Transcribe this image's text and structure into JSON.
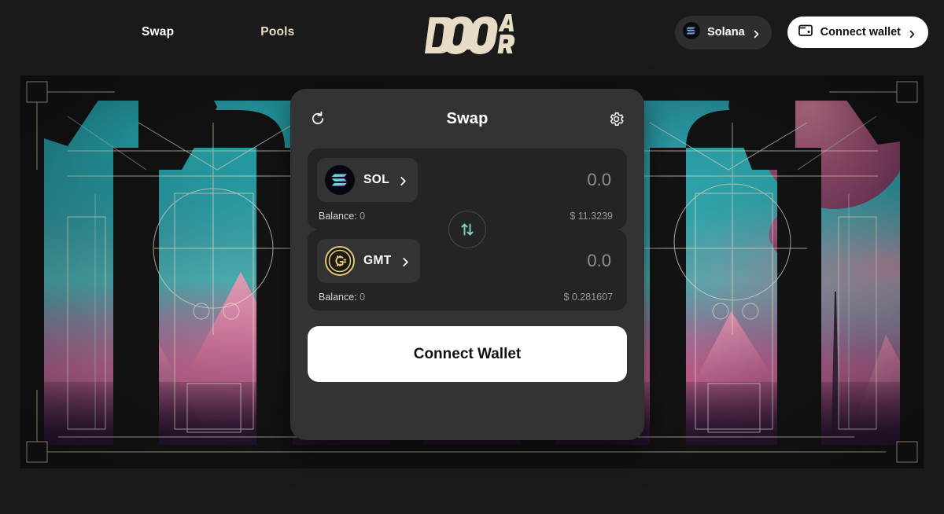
{
  "header": {
    "nav": [
      {
        "label": "Swap",
        "active": true
      },
      {
        "label": "Pools",
        "active": false
      }
    ],
    "logo_text": "DOOAR",
    "chain": {
      "label": "Solana",
      "icon": "solana-icon"
    },
    "wallet": {
      "label": "Connect wallet",
      "icon": "wallet-icon"
    }
  },
  "swap_card": {
    "title": "Swap",
    "refresh_icon": "refresh-icon",
    "settings_icon": "gear-icon",
    "switch_icon": "swap-direction-icon",
    "from": {
      "symbol": "SOL",
      "logo": "solana-token-icon",
      "amount": "0.0",
      "amount_placeholder": "0.0",
      "balance_label": "Balance:",
      "balance_value": "0",
      "usd_value": "$ 11.3239"
    },
    "to": {
      "symbol": "GMT",
      "logo": "gmt-token-icon",
      "amount": "0.0",
      "amount_placeholder": "0.0",
      "balance_label": "Balance:",
      "balance_value": "0",
      "usd_value": "$ 0.281607"
    },
    "cta_label": "Connect Wallet"
  },
  "colors": {
    "page_bg": "#1a1a1a",
    "card_bg": "#333333",
    "panel_bg": "#242424",
    "accent_cream": "#e8dcc6",
    "cta_bg": "#ffffff",
    "switch_arrow": "#7fd4c8",
    "gmt_gold": "#e3c77a"
  }
}
